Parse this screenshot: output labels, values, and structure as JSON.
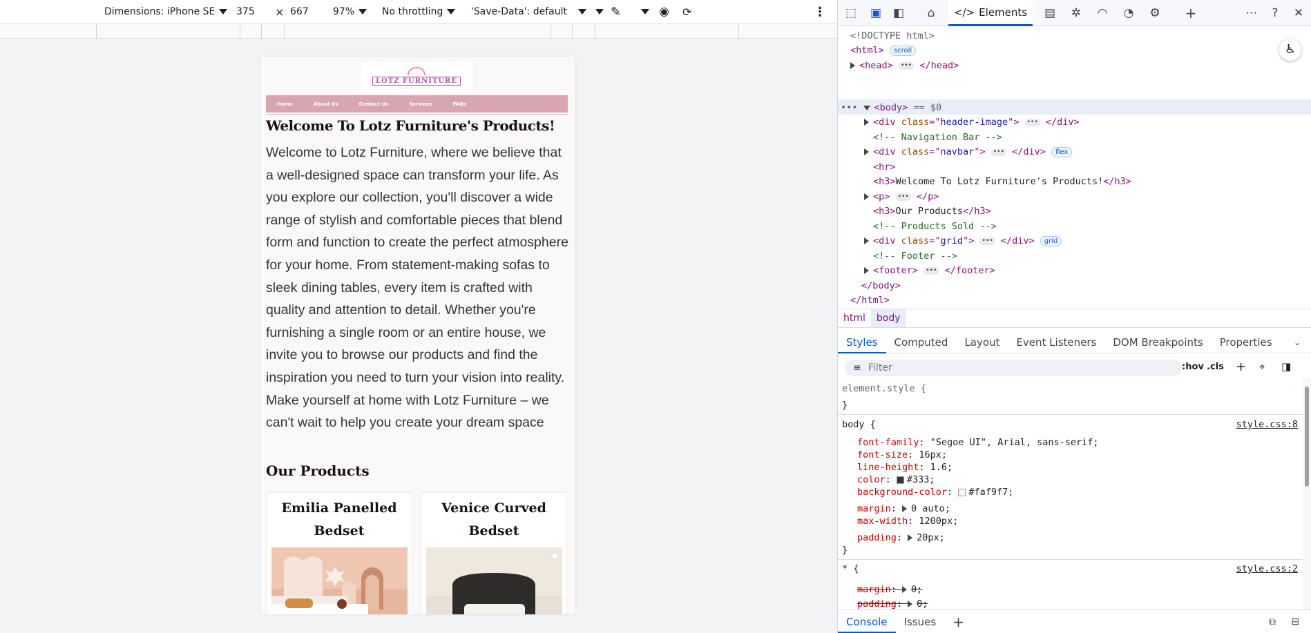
{
  "emulation": {
    "device_label": "Dimensions: iPhone SE",
    "width": "375",
    "times": "×",
    "height": "667",
    "zoom": "97%",
    "throttling": "No throttling",
    "save_data": "'Save-Data': default"
  },
  "page": {
    "logo_text": "LOTZ FURNITURE",
    "nav": [
      "Home",
      "About Us",
      "Contact Us",
      "Services",
      "FAQs"
    ],
    "title": "Welcome To Lotz Furniture's Products!",
    "intro": "Welcome to Lotz Furniture, where we believe that a well-designed space can transform your life. As you explore our collection, you'll discover a wide range of stylish and comfortable pieces that blend form and function to create the perfect atmosphere for your home. From statement-making sofas to sleek dining tables, every item is crafted with quality and attention to detail. Whether you're furnishing a single room or an entire house, we invite you to browse our products and find the inspiration you need to turn your vision into reality. Make yourself at home with Lotz Furniture – we can't wait to help you create your dream space",
    "products_heading": "Our Products",
    "products": [
      {
        "name": "Emilia Panelled Bedset"
      },
      {
        "name": "Venice Curved Bedset"
      }
    ]
  },
  "devtools": {
    "active_tab": "Elements",
    "dom": {
      "doctype": "<!DOCTYPE html>",
      "html_open": "<html>",
      "scroll_badge": "scroll",
      "head": "head",
      "body": "body",
      "selected_marker": "== $0",
      "div_header_class": "header-image",
      "comment_nav": "<!-- Navigation Bar -->",
      "div_navbar_class": "navbar",
      "flex_badge": "flex",
      "hr": "<hr>",
      "h3_welcome_text": "Welcome To Lotz Furniture's Products!",
      "p": "p",
      "h3_products_text": "Our Products",
      "comment_products": "<!-- Products Sold -->",
      "div_grid_class": "grid",
      "grid_badge": "grid",
      "comment_footer": "<!-- Footer -->",
      "footer": "footer",
      "body_close": "</body>",
      "html_close": "</html>"
    },
    "breadcrumbs": [
      "html",
      "body"
    ],
    "style_tabs": [
      "Styles",
      "Computed",
      "Layout",
      "Event Listeners",
      "DOM Breakpoints",
      "Properties"
    ],
    "active_style_tab": "Styles",
    "filter_placeholder": "Filter",
    "hov": ":hov",
    "cls": ".cls",
    "rules": {
      "element_style": "element.style {",
      "close": "}",
      "body_selector": "body {",
      "body_source": "style.css:8",
      "body_props": [
        {
          "name": "font-family",
          "value": "\"Segoe UI\", Arial, sans-serif;"
        },
        {
          "name": "font-size",
          "value": "16px;"
        },
        {
          "name": "line-height",
          "value": "1.6;"
        },
        {
          "name": "color",
          "value": "#333;"
        },
        {
          "name": "background-color",
          "value": "#faf9f7;"
        },
        {
          "name": "margin",
          "value": "0 auto;"
        },
        {
          "name": "max-width",
          "value": "1200px;"
        },
        {
          "name": "padding",
          "value": "20px;"
        }
      ],
      "star_selector": "* {",
      "star_source": "style.css:2",
      "star_props": [
        {
          "name": "margin",
          "value": "0;"
        },
        {
          "name": "padding",
          "value": "0;"
        }
      ]
    },
    "drawer_tabs": [
      "Console",
      "Issues"
    ],
    "swatches": {
      "color": "#333333",
      "background": "#faf9f7"
    }
  }
}
